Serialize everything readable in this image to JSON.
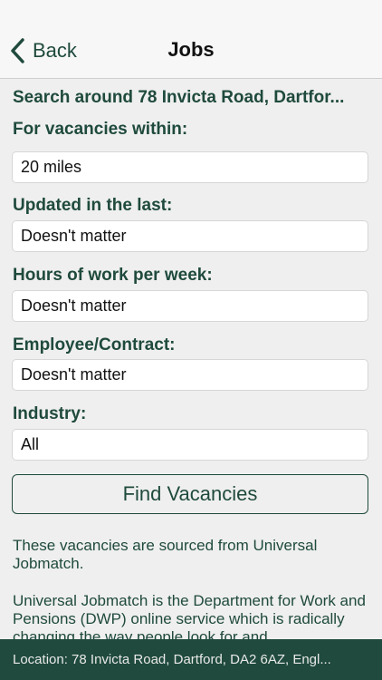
{
  "nav": {
    "back_label": "Back",
    "title": "Jobs"
  },
  "search": {
    "heading": "Search around 78 Invicta Road, Dartfor..."
  },
  "filters": {
    "distance": {
      "label": "For vacancies within:",
      "value": "20 miles"
    },
    "updated": {
      "label": "Updated in the last:",
      "value": "Doesn't matter"
    },
    "hours": {
      "label": "Hours of work per week:",
      "value": "Doesn't matter"
    },
    "contract": {
      "label": "Employee/Contract:",
      "value": "Doesn't matter"
    },
    "industry": {
      "label": "Industry:",
      "value": "All"
    }
  },
  "actions": {
    "find_label": "Find Vacancies"
  },
  "info": {
    "sourced": "These vacancies are sourced from Universal Jobmatch.",
    "about": "Universal Jobmatch is the Department for Work and Pensions (DWP) online service which is radically changing the way people look for and"
  },
  "footer": {
    "location": "Location: 78 Invicta Road, Dartford, DA2 6AZ, Engl..."
  },
  "colors": {
    "accent": "#1f4a3d",
    "background": "#efefef",
    "field_background": "#ffffff"
  }
}
